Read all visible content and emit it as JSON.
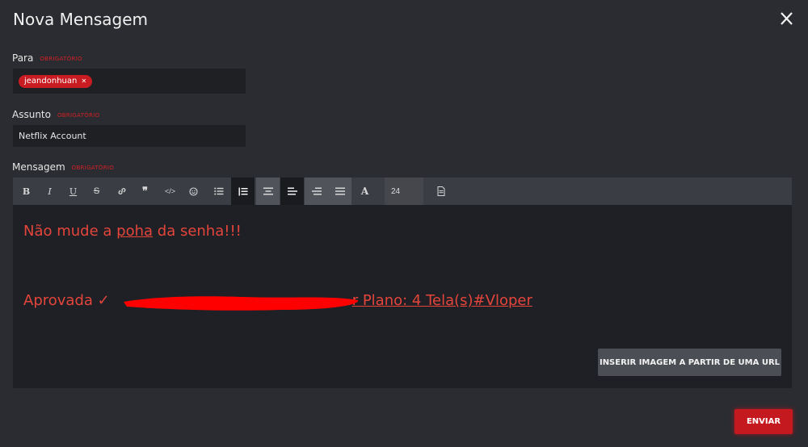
{
  "dialog": {
    "title": "Nova Mensagem",
    "close_label": "X"
  },
  "fields": {
    "to": {
      "label": "Para",
      "required": "OBRIGATÓRIO",
      "recipient": "jeandonhuan",
      "recipient_remove": "✕"
    },
    "subject": {
      "label": "Assunto",
      "required": "OBRIGATÓRIO",
      "value": "Netflix Account"
    },
    "message": {
      "label": "Mensagem",
      "required": "OBRIGATÓRIO"
    }
  },
  "toolbar": {
    "bold": "B",
    "italic": "I",
    "underline": "U",
    "strike": "S",
    "font_size": "24"
  },
  "editor": {
    "line1_pre": "Não mude a ",
    "line1_underlined": "poha",
    "line1_post": " da senha!!!",
    "line2_start": "Aprovada ✓",
    "line2_end": "r Plano: 4 Tela(s)#Vloper"
  },
  "buttons": {
    "insert_image": "INSERIR IMAGEM A PARTIR DE UMA URL",
    "send": "ENVIAR"
  },
  "colors": {
    "accent": "#c91c22",
    "message_text": "#e4453b",
    "background": "#2b2c31"
  }
}
